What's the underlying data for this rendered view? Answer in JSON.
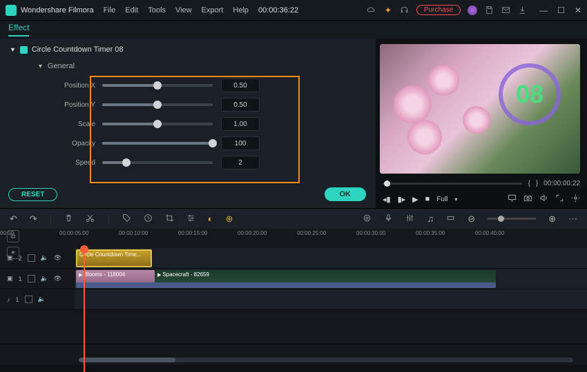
{
  "app": {
    "brand": "Wondershare Filmora",
    "timecode": "00:00:36:22",
    "purchase": "Purchase"
  },
  "menu": [
    "File",
    "Edit",
    "Tools",
    "View",
    "Export",
    "Help"
  ],
  "tab": "Effect",
  "effect": {
    "title": "Circle Countdown Timer 08",
    "section": "General",
    "params": [
      {
        "label": "Position X",
        "value": "0.50",
        "pct": 50
      },
      {
        "label": "Position Y",
        "value": "0.50",
        "pct": 50
      },
      {
        "label": "Scale",
        "value": "1.00",
        "pct": 50
      },
      {
        "label": "Opacity",
        "value": "100",
        "pct": 100
      },
      {
        "label": "Speed",
        "value": "2",
        "pct": 22
      }
    ],
    "reset": "RESET",
    "ok": "OK"
  },
  "preview": {
    "num": "08",
    "brace_l": "{",
    "brace_r": "}",
    "time": "00:00:00:22",
    "full": "Full"
  },
  "ruler": [
    "00:00",
    "00:00:05:00",
    "00:00:10:00",
    "00:00:15:00",
    "00:00:20:00",
    "00:00:25:00",
    "00:00:30:00",
    "00:00:35:00",
    "00:00:40:00"
  ],
  "tracks": {
    "t2": "2",
    "t1": "1",
    "a1": "1",
    "fx_clip": "Circle Countdown Time...",
    "v1_clip": "Blooms - 118004",
    "v2_clip": "Spacecraft - 82659"
  }
}
